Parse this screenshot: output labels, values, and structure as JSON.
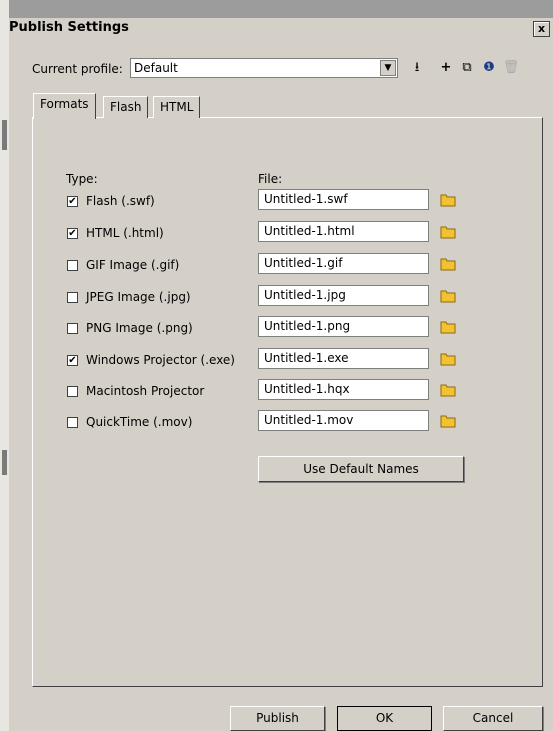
{
  "window": {
    "title": "Publish Settings",
    "close_glyph": "x"
  },
  "profile": {
    "label": "Current profile:",
    "value": "Default",
    "tools": [
      {
        "name": "import-export-icon",
        "glyph": "⭳"
      },
      {
        "name": "add-profile-icon",
        "glyph": "+"
      },
      {
        "name": "duplicate-profile-icon",
        "glyph": "⧉"
      },
      {
        "name": "profile-properties-icon",
        "glyph": "❶"
      },
      {
        "name": "delete-profile-icon",
        "glyph": "🗑"
      }
    ]
  },
  "tabs": [
    "Formats",
    "Flash",
    "HTML"
  ],
  "columns": {
    "type": "Type:",
    "file": "File:"
  },
  "formats": [
    {
      "label": "Flash  (.swf)",
      "checked": true,
      "file": "Untitled-1.swf"
    },
    {
      "label": "HTML  (.html)",
      "checked": true,
      "file": "Untitled-1.html"
    },
    {
      "label": "GIF Image (.gif)",
      "checked": false,
      "file": "Untitled-1.gif"
    },
    {
      "label": "JPEG Image (.jpg)",
      "checked": false,
      "file": "Untitled-1.jpg"
    },
    {
      "label": "PNG Image (.png)",
      "checked": false,
      "file": "Untitled-1.png"
    },
    {
      "label": "Windows Projector (.exe)",
      "checked": true,
      "file": "Untitled-1.exe"
    },
    {
      "label": "Macintosh Projector",
      "checked": false,
      "file": "Untitled-1.hqx"
    },
    {
      "label": "QuickTime (.mov)",
      "checked": false,
      "file": "Untitled-1.mov"
    }
  ],
  "use_default_names": "Use Default Names",
  "footer": {
    "publish": "Publish",
    "ok": "OK",
    "cancel": "Cancel"
  },
  "colors": {
    "dialog_bg": "#d4d0c8",
    "folder": "#f2c230"
  }
}
